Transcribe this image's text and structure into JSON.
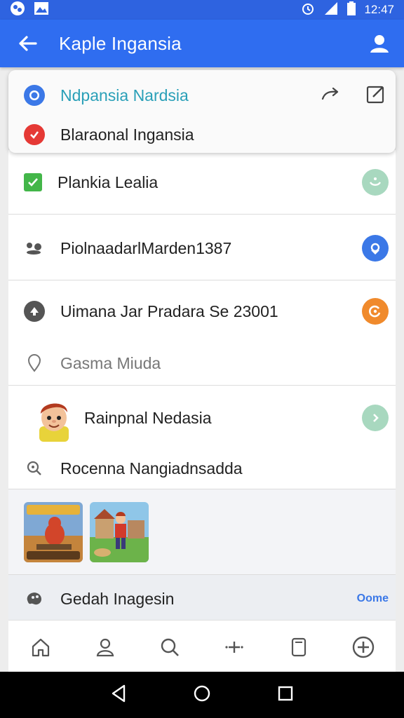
{
  "status_bar": {
    "time": "12:47"
  },
  "app_bar": {
    "title": "Kaple Ingansia"
  },
  "top_card": {
    "row1": {
      "label": "Ndpansia Nardsia"
    },
    "row2": {
      "label": "Blaraonal Ingansia"
    }
  },
  "items": [
    {
      "label": "Plankia Lealia"
    },
    {
      "label": "PiolnaadarlMarden1387"
    },
    {
      "label": "Uimana Jar Pradara Se 23001"
    },
    {
      "label": "Gasma Miuda"
    },
    {
      "label": "Rainpnal Nedasia"
    },
    {
      "label": "Rocenna Nangiadnsadda"
    }
  ],
  "footer_row": {
    "label": "Gedah Inagesin",
    "action": "Oome"
  },
  "colors": {
    "app_bar": "#2f6df0",
    "blue": "#3b78e7",
    "red": "#e53935",
    "green": "#43b649",
    "mint": "#a8d8bf",
    "orange": "#f08a2c"
  }
}
